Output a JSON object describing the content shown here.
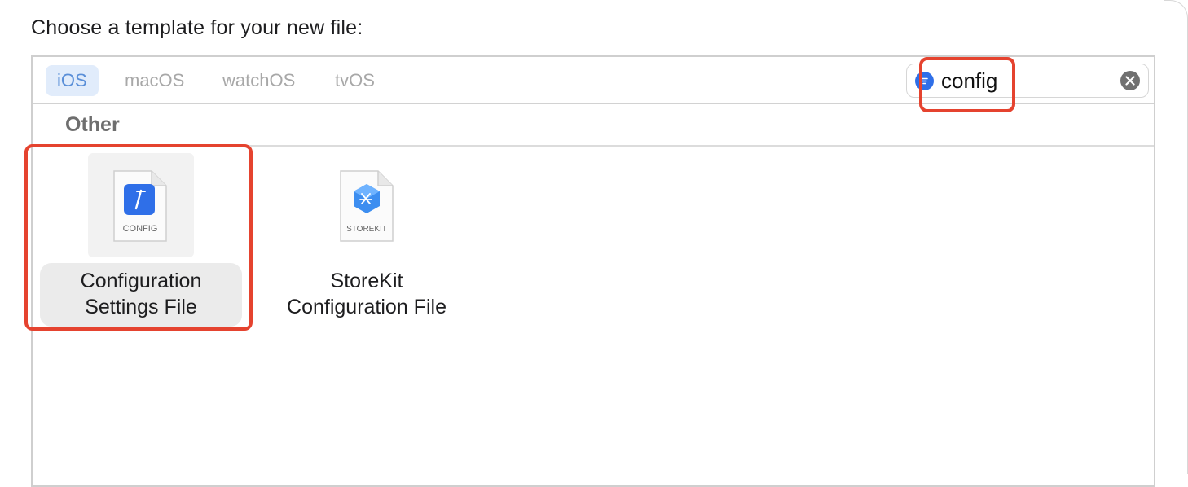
{
  "prompt": "Choose a template for your new file:",
  "platform_tabs": [
    {
      "label": "iOS",
      "selected": true
    },
    {
      "label": "macOS",
      "selected": false
    },
    {
      "label": "watchOS",
      "selected": false
    },
    {
      "label": "tvOS",
      "selected": false
    }
  ],
  "search": {
    "value": "config",
    "icon": "filter-icon",
    "clear_icon": "clear-icon"
  },
  "section": {
    "title": "Other"
  },
  "templates": [
    {
      "name_line1": "Configuration",
      "name_line2": "Settings File",
      "badge": "CONFIG",
      "icon": "config-file-icon",
      "selected": true
    },
    {
      "name_line1": "StoreKit",
      "name_line2": "Configuration File",
      "badge": "STOREKIT",
      "icon": "storekit-file-icon",
      "selected": false
    }
  ],
  "colors": {
    "accent": "#2f6fe8",
    "highlight": "#e5432f",
    "tab_selected_bg": "#e1ecfb",
    "tab_selected_text": "#5a8fd8"
  }
}
